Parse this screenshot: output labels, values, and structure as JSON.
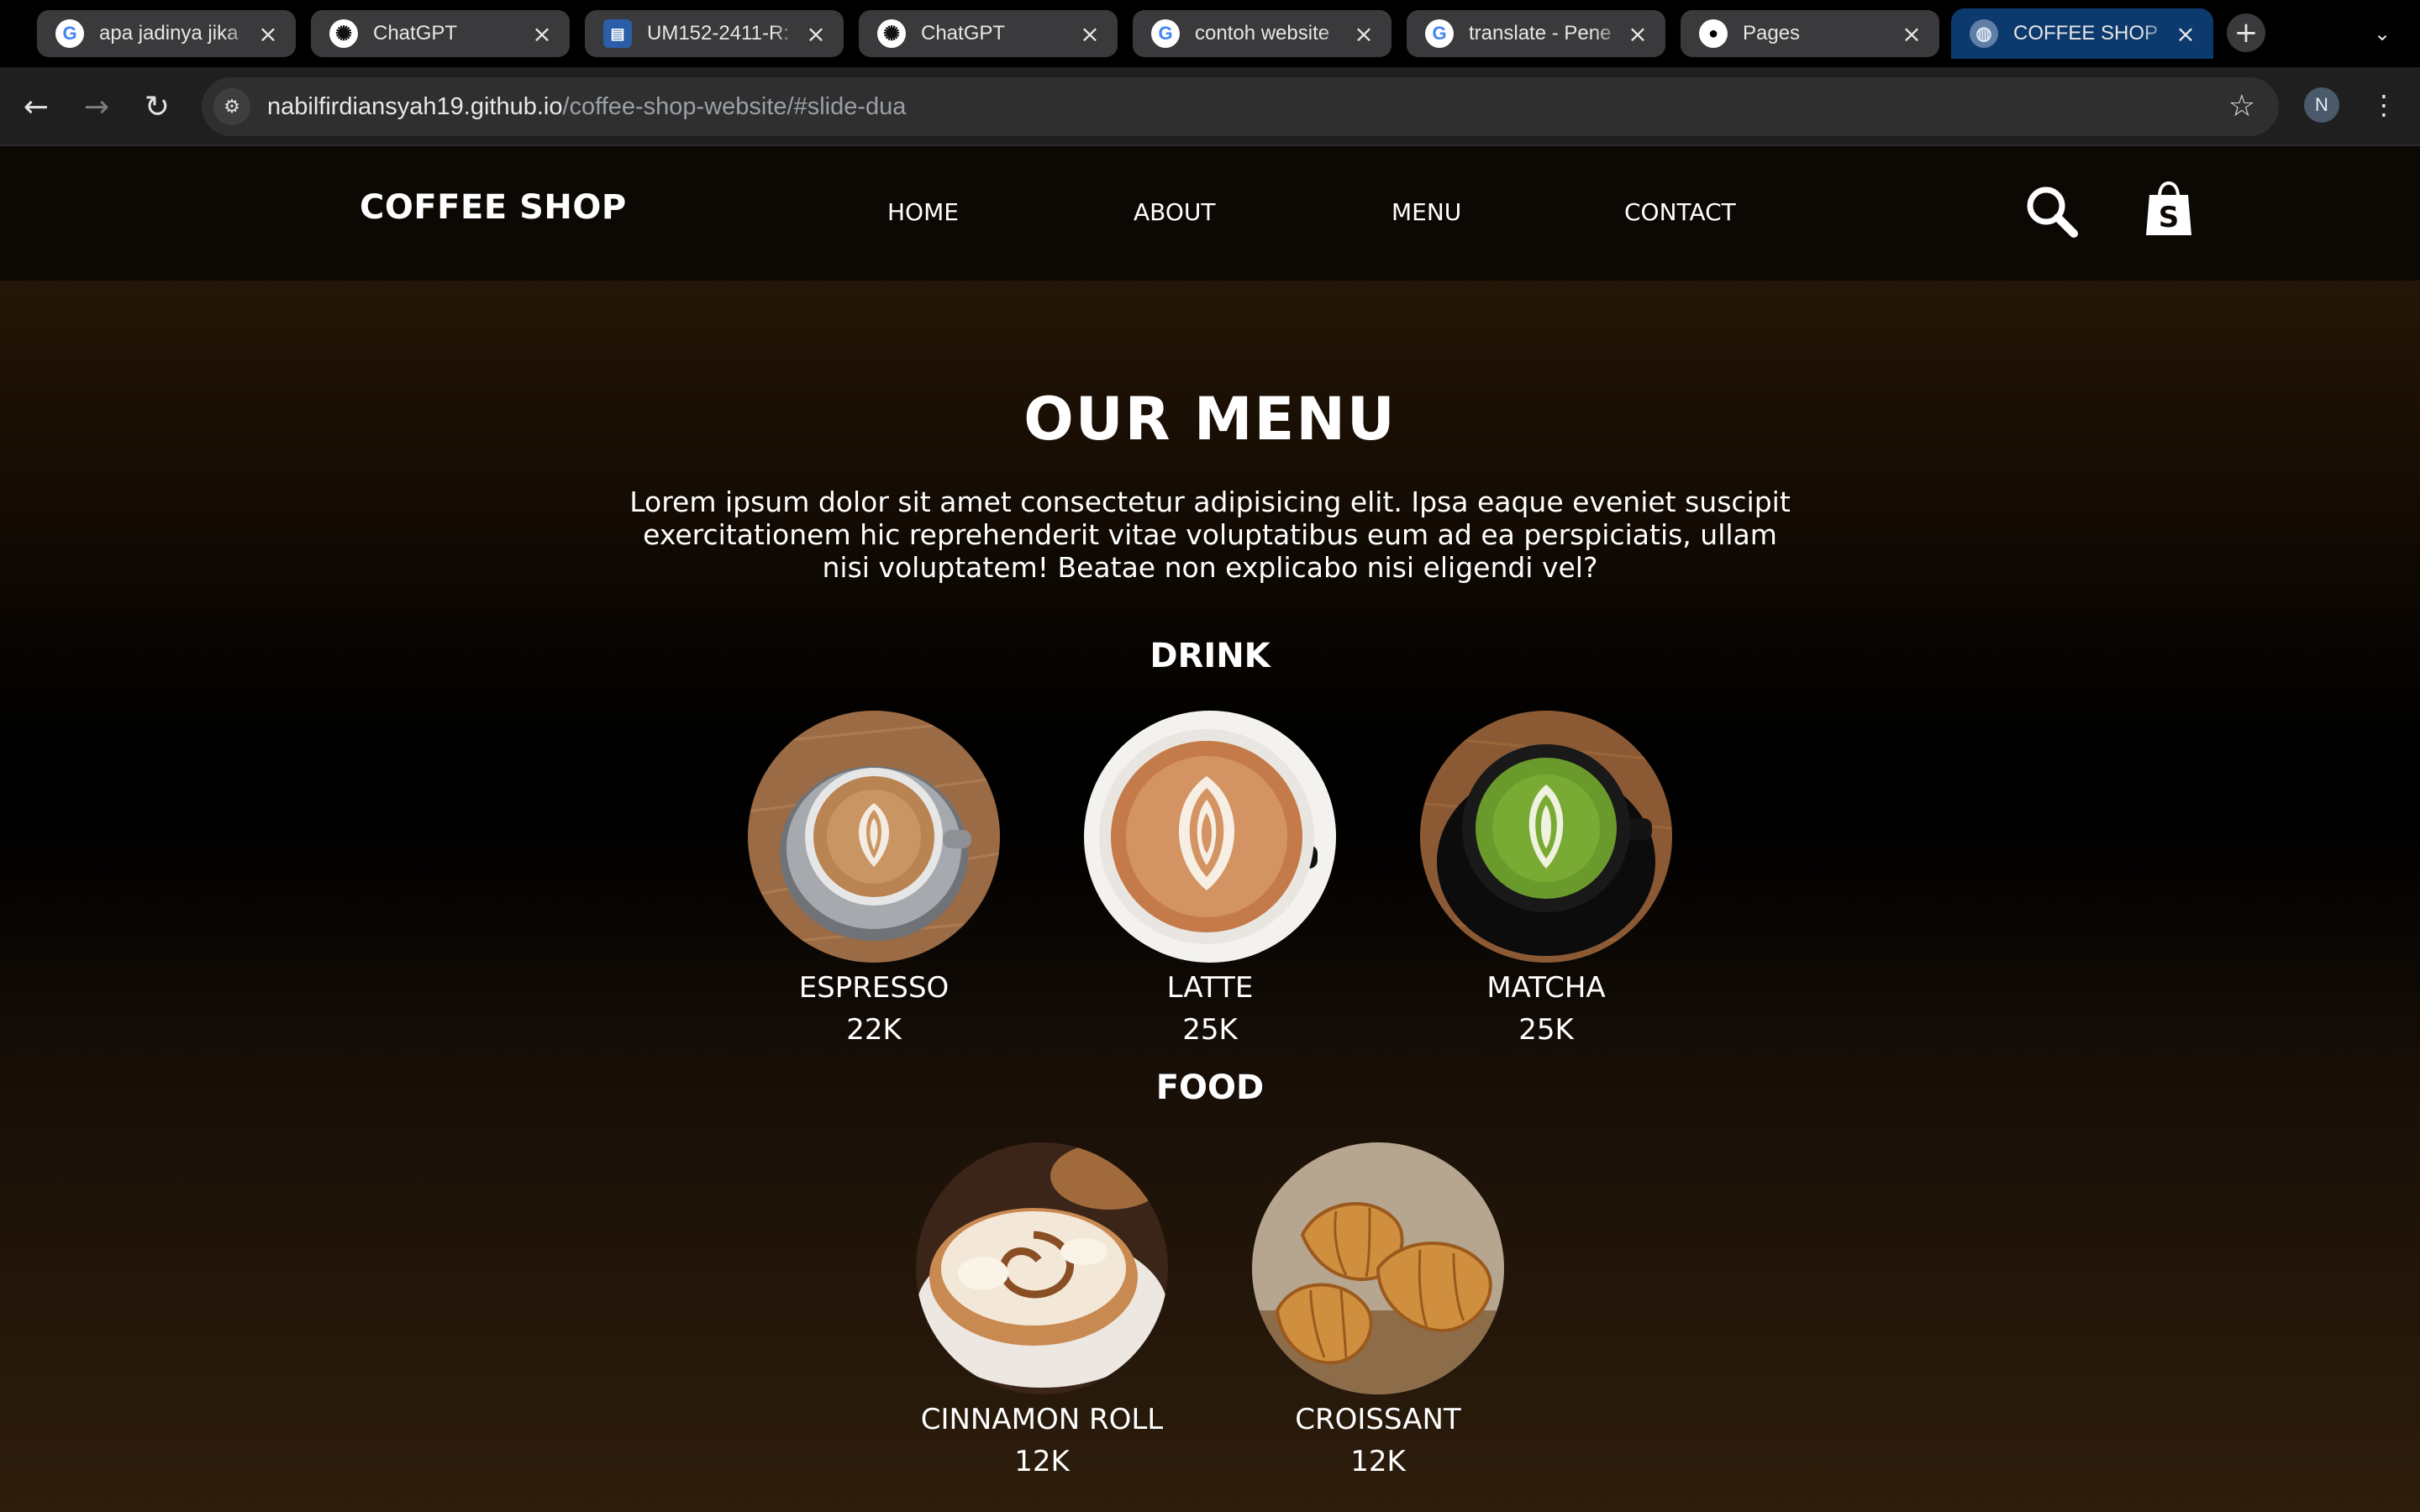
{
  "browser": {
    "tabs": [
      {
        "label": "apa jadinya jika",
        "icon": "google-icon"
      },
      {
        "label": "ChatGPT",
        "icon": "chatgpt-icon"
      },
      {
        "label": "UM152-2411-R:",
        "icon": "document-icon"
      },
      {
        "label": "ChatGPT",
        "icon": "chatgpt-icon"
      },
      {
        "label": "contoh website",
        "icon": "google-icon"
      },
      {
        "label": "translate - Pene",
        "icon": "google-icon"
      },
      {
        "label": "Pages",
        "icon": "github-icon"
      },
      {
        "label": "COFFEE SHOP",
        "icon": "globe-icon",
        "active": true
      }
    ],
    "url_host": "nabilfirdiansyah19.github.io",
    "url_path": "/coffee-shop-website/#slide-dua",
    "profile_initial": "N"
  },
  "site": {
    "brand": "COFFEE SHOP",
    "nav": [
      "HOME",
      "ABOUT",
      "MENU",
      "CONTACT"
    ],
    "icons": [
      "search-icon",
      "shopify-bag-icon"
    ]
  },
  "menu": {
    "title": "OUR MENU",
    "intro": "Lorem ipsum dolor sit amet consectetur adipisicing elit. Ipsa eaque eveniet suscipit exercitationem hic reprehenderit vitae voluptatibus eum ad ea perspiciatis, ullam nisi voluptatem! Beatae non explicabo nisi eligendi vel?",
    "drink_title": "DRINK",
    "drinks": [
      {
        "name": "ESPRESSO",
        "price": "22K"
      },
      {
        "name": "LATTE",
        "price": "25K"
      },
      {
        "name": "MATCHA",
        "price": "25K"
      }
    ],
    "food_title": "FOOD",
    "foods": [
      {
        "name": "CINNAMON ROLL",
        "price": "12K"
      },
      {
        "name": "CROISSANT",
        "price": "12K"
      }
    ]
  }
}
